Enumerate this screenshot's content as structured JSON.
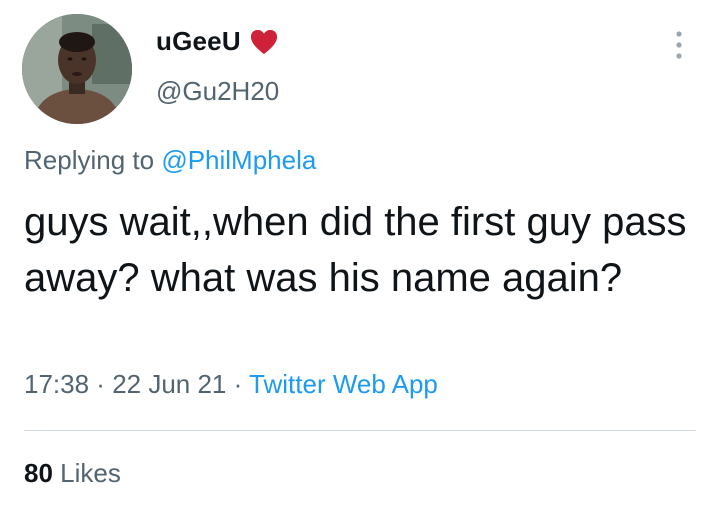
{
  "user": {
    "display_name": "uGeeU",
    "handle": "@Gu2H20",
    "emoji": "heart-icon"
  },
  "reply": {
    "prefix": "Replying to ",
    "mention": "@PhilMphela"
  },
  "tweet": {
    "text": "guys wait,,when did the first guy pass away? what was his name again?"
  },
  "meta": {
    "time": "17:38",
    "separator1": " · ",
    "date": "22 Jun 21",
    "separator2": " · ",
    "source": "Twitter Web App"
  },
  "stats": {
    "likes_count": "80",
    "likes_label": " Likes"
  },
  "colors": {
    "link": "#1d9bf0",
    "secondary_text": "#536471",
    "primary_text": "#0f1419",
    "heart": "#e0245e"
  }
}
